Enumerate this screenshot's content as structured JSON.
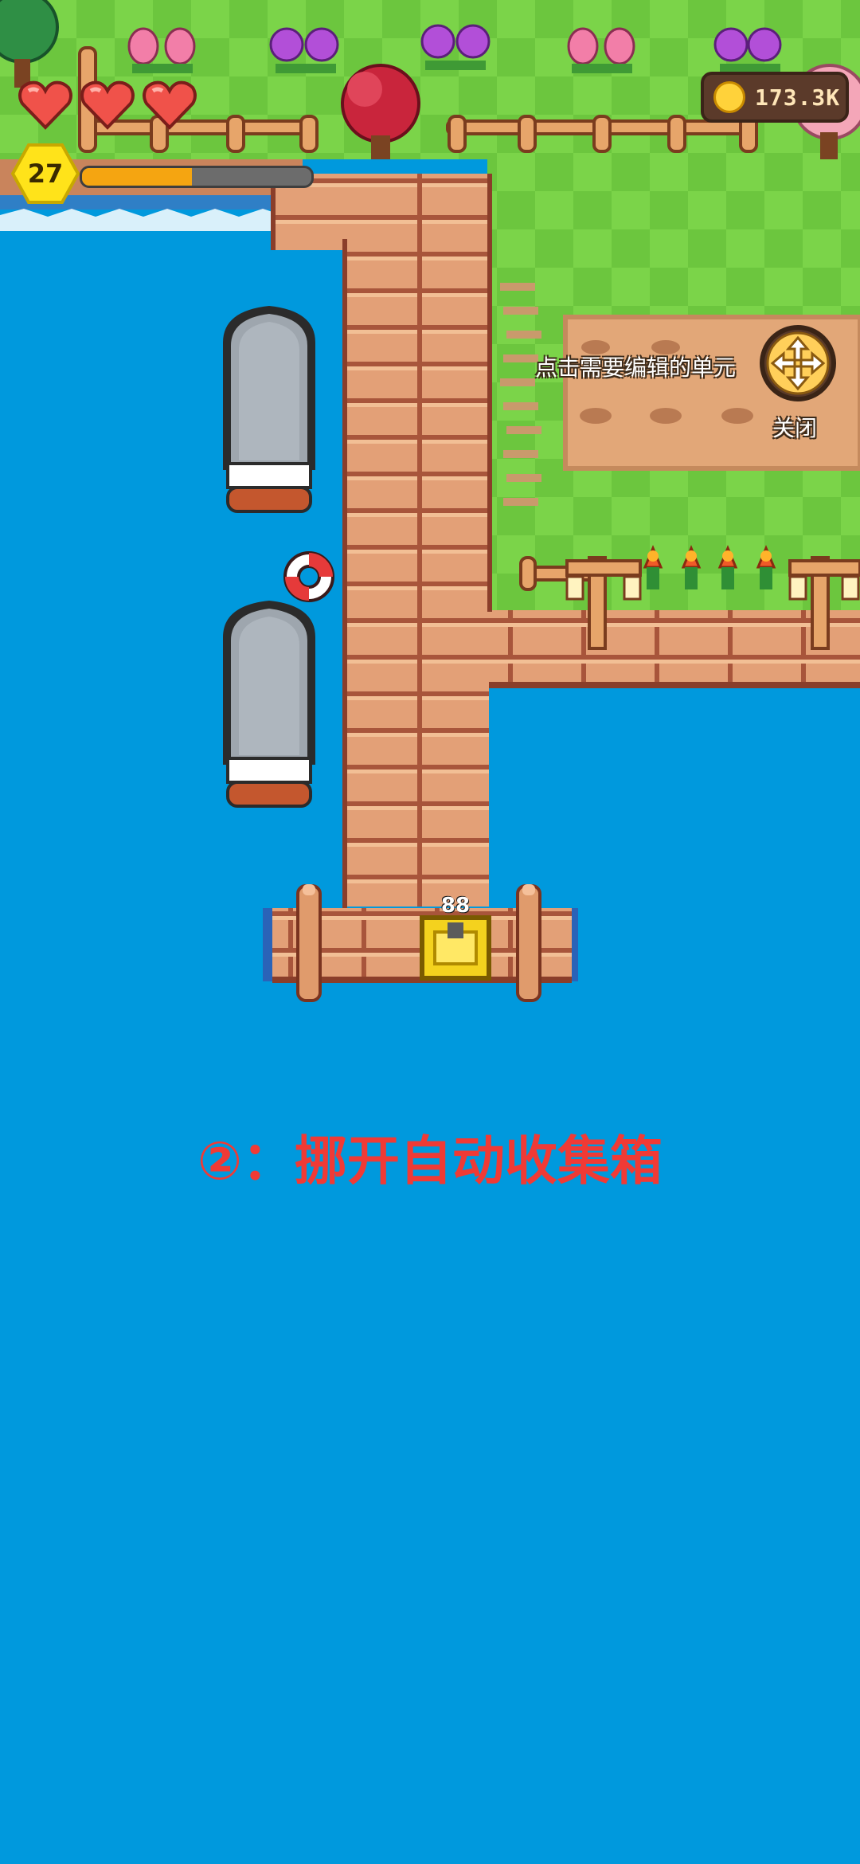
{
  "hud": {
    "hearts": 3,
    "level": "27",
    "xp_progress": 0.48,
    "coins": "173.3K"
  },
  "editor": {
    "hint": "点击需要编辑的单元",
    "close_label": "关闭",
    "move_icon": "move-arrows-icon"
  },
  "scene": {
    "collector_box_count": "88",
    "instruction": "②：挪开自动收集箱"
  },
  "colors": {
    "water": "#0099dd",
    "grass_light": "#7bd449",
    "grass_dark": "#6cc63e",
    "dock_wood": "#e3a077",
    "dock_shadow": "#a8553b",
    "dirt": "#e2a778",
    "instruction_red": "#f03a35",
    "xp_fill": "#f5a511",
    "coin_gold": "#ffd23a"
  }
}
